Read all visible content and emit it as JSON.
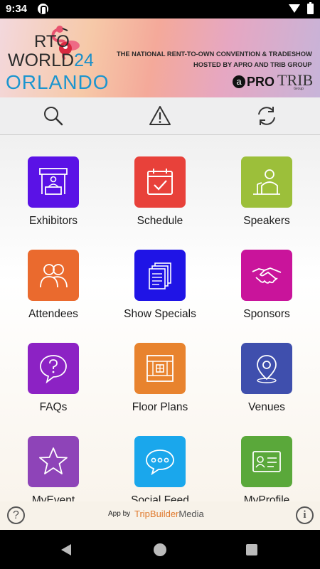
{
  "status_bar": {
    "time": "9:34"
  },
  "banner": {
    "logo_rto": "RTO",
    "logo_world": "WORLD",
    "logo_year": "24",
    "city": "ORLANDO",
    "tagline_line1": "THE NATIONAL RENT-TO-OWN CONVENTION & TRADESHOW",
    "tagline_line2": "HOSTED BY APRO AND TRIB GROUP",
    "sponsor1_mark": "a",
    "sponsor1_name": "PRO",
    "sponsor2_name": "TRIB",
    "sponsor2_sub": "Group"
  },
  "toolbar": {
    "icons": [
      "search-icon",
      "alert-icon",
      "refresh-icon"
    ]
  },
  "tiles": [
    {
      "label": "Exhibitors",
      "color": "#5a12e6",
      "icon": "booth-icon"
    },
    {
      "label": "Schedule",
      "color": "#e8413a",
      "icon": "calendar-icon"
    },
    {
      "label": "Speakers",
      "color": "#9cbf3a",
      "icon": "podium-speaker-icon"
    },
    {
      "label": "Attendees",
      "color": "#ea6a2e",
      "icon": "people-icon"
    },
    {
      "label": "Show Specials",
      "color": "#1f14e6",
      "icon": "documents-icon"
    },
    {
      "label": "Sponsors",
      "color": "#c9149b",
      "icon": "handshake-icon"
    },
    {
      "label": "FAQs",
      "color": "#8c22c4",
      "icon": "question-bubble-icon"
    },
    {
      "label": "Floor Plans",
      "color": "#e8832e",
      "icon": "floor-plan-icon"
    },
    {
      "label": "Venues",
      "color": "#3f4fad",
      "icon": "map-pin-icon"
    },
    {
      "label": "MyEvent",
      "color": "#8e44b8",
      "icon": "star-icon"
    },
    {
      "label": "Social Feed",
      "color": "#1aa7ec",
      "icon": "chat-bubble-icon"
    },
    {
      "label": "MyProfile",
      "color": "#5aa83a",
      "icon": "id-card-icon"
    }
  ],
  "footer": {
    "help": "?",
    "info": "i",
    "credit_prefix": "App by",
    "credit_brand": "TripBuilder",
    "credit_brand_suffix": "Media"
  }
}
